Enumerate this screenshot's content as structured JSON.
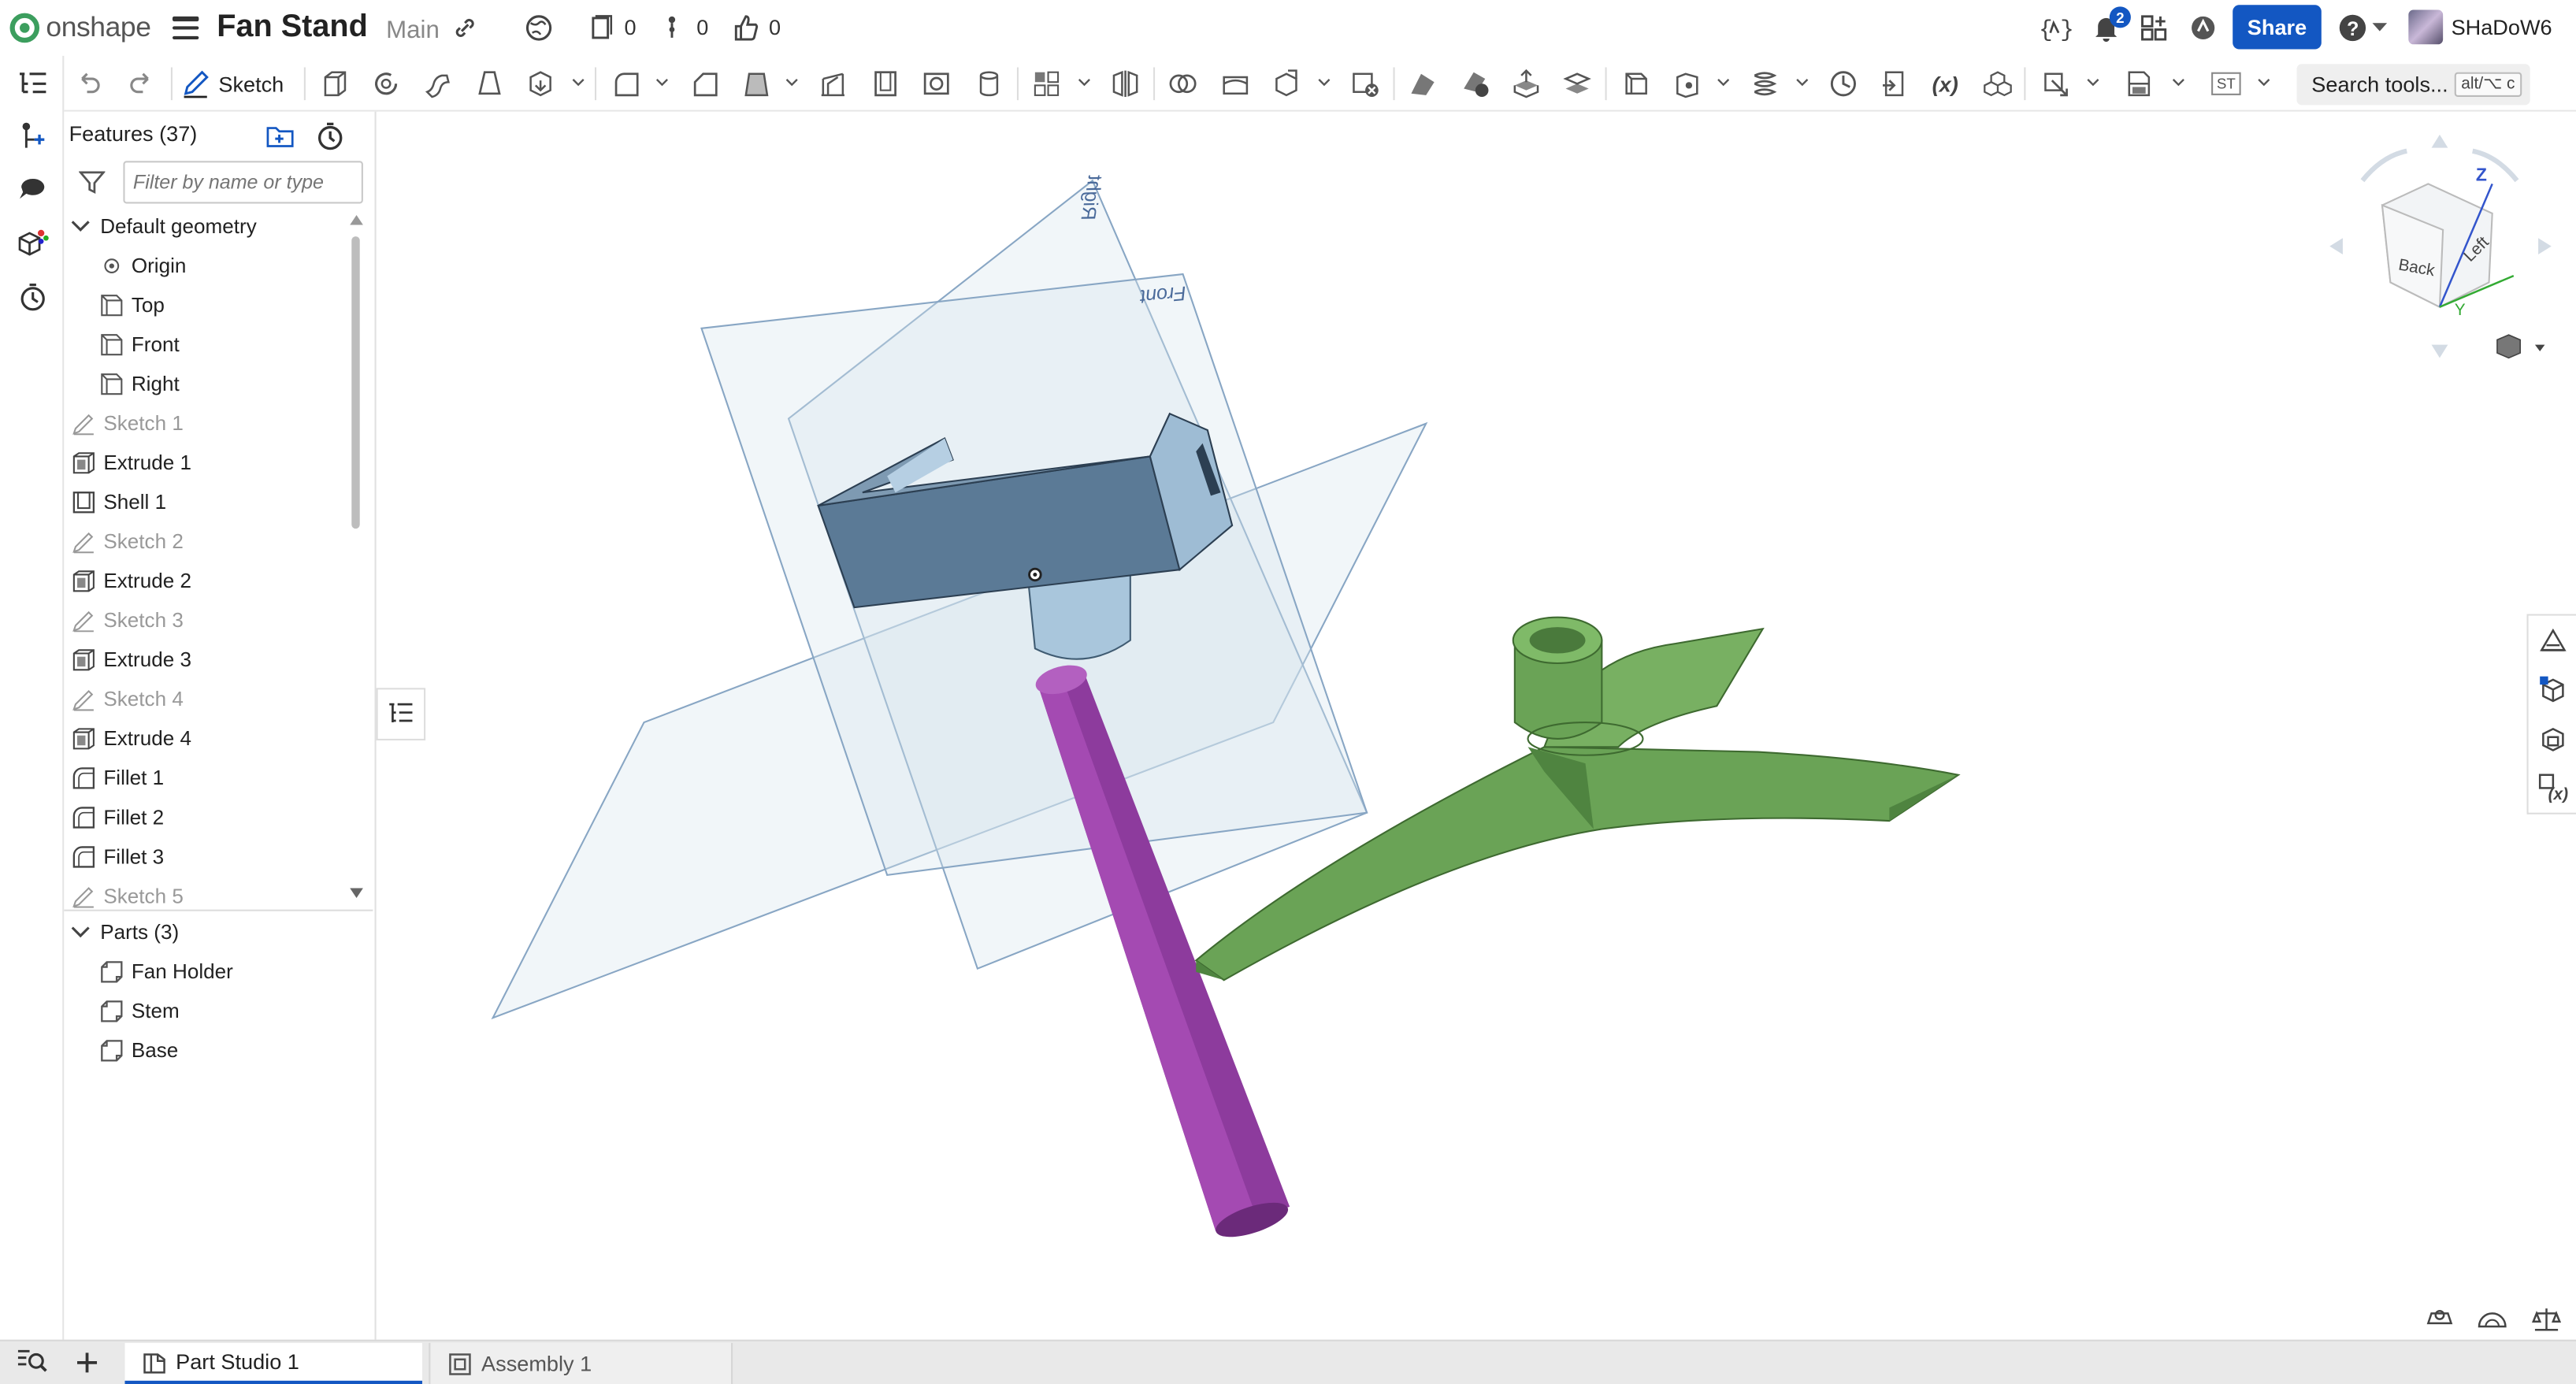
{
  "app": {
    "brand": "onshape",
    "document_title": "Fan Stand",
    "branch": "Main",
    "counts": {
      "versions": "0",
      "branches": "0",
      "likes": "0"
    },
    "notifications_count": "2",
    "share_label": "Share",
    "username": "SHaDoW6"
  },
  "toolbar": {
    "sketch_label": "Sketch",
    "search_label": "Search tools...",
    "search_shortcut": "alt/⌥ c",
    "st_label": "ST",
    "variable_label": "(x)"
  },
  "features": {
    "title": "Features (37)",
    "filter_placeholder": "Filter by name or type",
    "default_geometry_label": "Default geometry",
    "items": [
      {
        "label": "Origin",
        "icon": "origin-icon",
        "dim": false
      },
      {
        "label": "Top",
        "icon": "plane-icon",
        "dim": false
      },
      {
        "label": "Front",
        "icon": "plane-icon",
        "dim": false
      },
      {
        "label": "Right",
        "icon": "plane-icon",
        "dim": false
      },
      {
        "label": "Sketch 1",
        "icon": "sketch-icon",
        "dim": true
      },
      {
        "label": "Extrude 1",
        "icon": "extrude-icon",
        "dim": false
      },
      {
        "label": "Shell 1",
        "icon": "shell-icon",
        "dim": false
      },
      {
        "label": "Sketch 2",
        "icon": "sketch-icon",
        "dim": true
      },
      {
        "label": "Extrude 2",
        "icon": "extrude-icon",
        "dim": false
      },
      {
        "label": "Sketch 3",
        "icon": "sketch-icon",
        "dim": true
      },
      {
        "label": "Extrude 3",
        "icon": "extrude-icon",
        "dim": false
      },
      {
        "label": "Sketch 4",
        "icon": "sketch-icon",
        "dim": true
      },
      {
        "label": "Extrude 4",
        "icon": "extrude-icon",
        "dim": false
      },
      {
        "label": "Fillet 1",
        "icon": "fillet-icon",
        "dim": false
      },
      {
        "label": "Fillet 2",
        "icon": "fillet-icon",
        "dim": false
      },
      {
        "label": "Fillet 3",
        "icon": "fillet-icon",
        "dim": false
      },
      {
        "label": "Sketch 5",
        "icon": "sketch-icon",
        "dim": true
      }
    ],
    "parts_label": "Parts (3)",
    "parts": [
      "Fan Holder",
      "Stem",
      "Base"
    ]
  },
  "viewport": {
    "plane_labels": {
      "right": "Right",
      "front": "Front"
    },
    "view_cube": {
      "back": "Back",
      "left": "Left",
      "z_axis": "Z",
      "y_axis": "Y"
    },
    "part_colors": {
      "fan_holder": "#5b7a96",
      "stem": "#8a3a9a",
      "base": "#5e9a4a"
    }
  },
  "tabs": [
    {
      "label": "Part Studio 1",
      "active": true
    },
    {
      "label": "Assembly 1",
      "active": false
    }
  ],
  "colors": {
    "accent": "#1357c2",
    "brand": "#3c9e5e"
  }
}
